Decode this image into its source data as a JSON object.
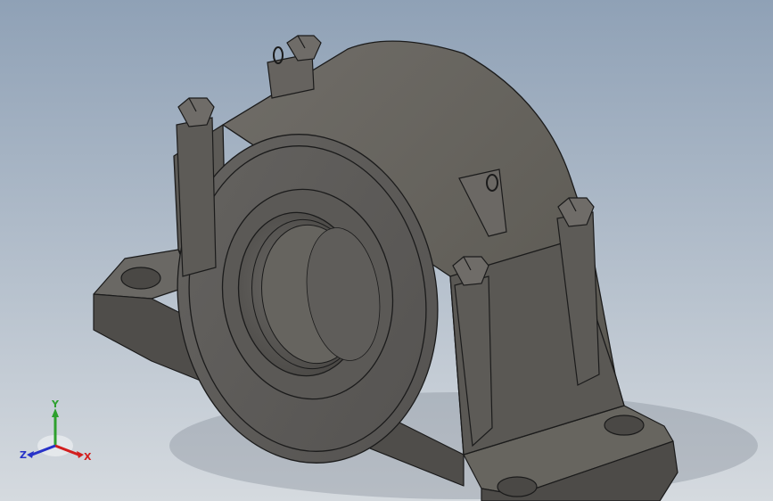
{
  "viewport": {
    "background_top": "#8fa1b6",
    "background_bottom": "#d5dadf",
    "model_color": "#5e5c58",
    "edge_color": "#1b1b1b"
  },
  "model": {
    "icon": "pillow-block-bearing-housing-icon"
  },
  "triad": {
    "x_label": "X",
    "y_label": "Y",
    "z_label": "Z",
    "x_color": "#d21e1e",
    "y_color": "#2ea02e",
    "z_color": "#2732c8"
  }
}
